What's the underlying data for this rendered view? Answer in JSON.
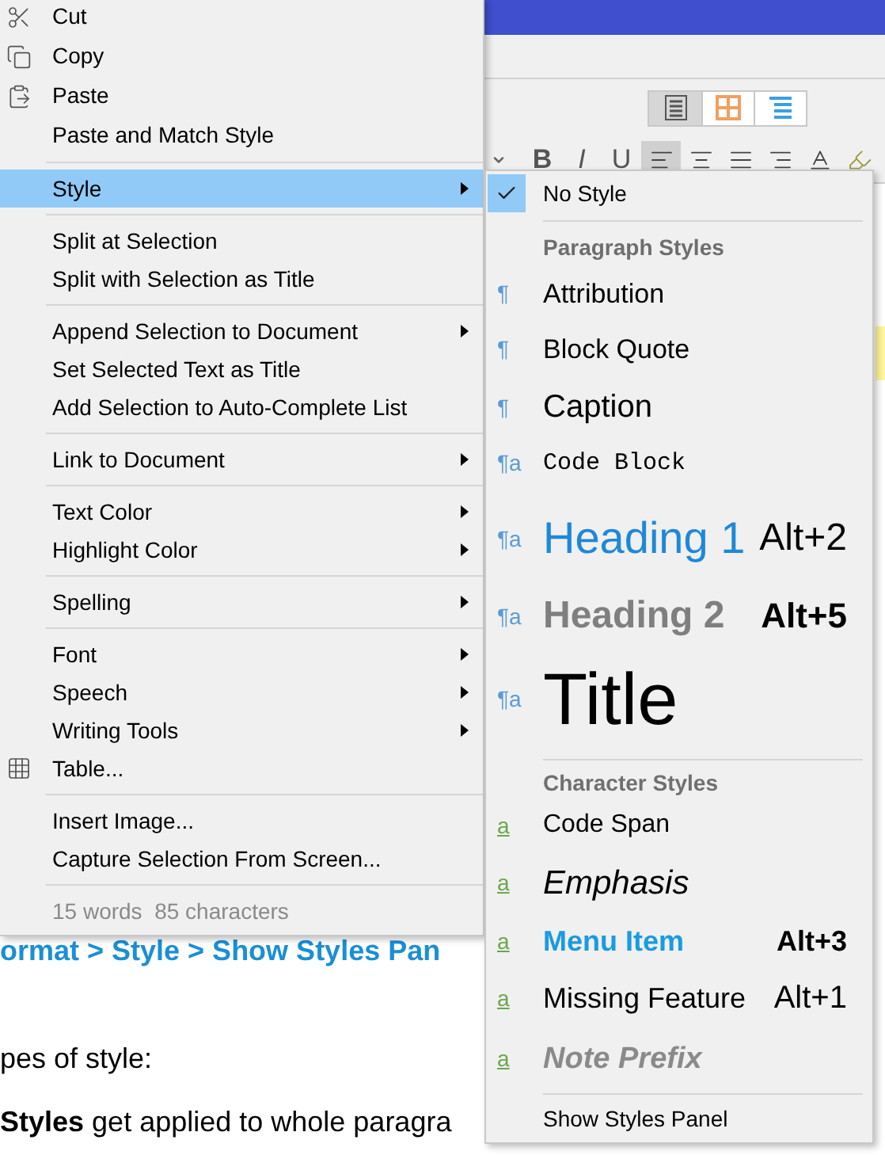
{
  "view_switcher": [
    {
      "kind": "list",
      "selected": true
    },
    {
      "kind": "grid",
      "selected": false
    },
    {
      "kind": "outline",
      "selected": false
    }
  ],
  "format_toolbar": [
    {
      "kind": "bold",
      "label": "B",
      "selected": false
    },
    {
      "kind": "italic",
      "label": "I",
      "selected": false
    },
    {
      "kind": "underline",
      "label": "U",
      "selected": false
    },
    {
      "kind": "align-left",
      "selected": true
    },
    {
      "kind": "align-center",
      "selected": false
    },
    {
      "kind": "align-justify",
      "selected": false
    },
    {
      "kind": "align-right",
      "selected": false
    },
    {
      "kind": "text-color",
      "selected": false
    },
    {
      "kind": "highlight",
      "selected": false
    }
  ],
  "document": {
    "lines": [
      {
        "kind": "link",
        "text": "ormat > Style > Show Styles Pan"
      },
      {
        "kind": "paragraph",
        "text": "pes of style:"
      },
      {
        "kind": "paragraph",
        "text": "**Styles** get applied to whole paragra"
      }
    ]
  },
  "context_menu": {
    "groups": [
      [
        {
          "label": "Cut",
          "kind": "cut",
          "has_submenu": false,
          "selected": false
        },
        {
          "label": "Copy",
          "kind": "copy",
          "has_submenu": false,
          "selected": false
        },
        {
          "label": "Paste",
          "kind": "paste",
          "has_submenu": false,
          "selected": false
        },
        {
          "label": "Paste and Match Style",
          "has_submenu": false,
          "selected": false
        }
      ],
      [
        {
          "label": "Style",
          "has_submenu": true,
          "selected": true
        }
      ],
      [
        {
          "label": "Split at Selection",
          "has_submenu": false,
          "selected": false
        },
        {
          "label": "Split with Selection as Title",
          "has_submenu": false,
          "selected": false
        }
      ],
      [
        {
          "label": "Append Selection to Document",
          "has_submenu": true,
          "selected": false
        },
        {
          "label": "Set Selected Text as Title",
          "has_submenu": false,
          "selected": false
        },
        {
          "label": "Add Selection to Auto-Complete List",
          "has_submenu": false,
          "selected": false
        }
      ],
      [
        {
          "label": "Link to Document",
          "has_submenu": true,
          "selected": false
        }
      ],
      [
        {
          "label": "Text Color",
          "has_submenu": true,
          "selected": false
        },
        {
          "label": "Highlight Color",
          "has_submenu": true,
          "selected": false
        }
      ],
      [
        {
          "label": "Spelling",
          "has_submenu": true,
          "selected": false
        }
      ],
      [
        {
          "label": "Font",
          "has_submenu": true,
          "selected": false
        },
        {
          "label": "Speech",
          "has_submenu": true,
          "selected": false
        },
        {
          "label": "Writing Tools",
          "has_submenu": true,
          "selected": false
        },
        {
          "label": "Table...",
          "kind": "table",
          "has_submenu": false,
          "selected": false
        }
      ],
      [
        {
          "label": "Insert Image...",
          "has_submenu": false,
          "selected": false
        },
        {
          "label": "Capture Selection From Screen...",
          "has_submenu": false,
          "selected": false
        }
      ]
    ],
    "status": "15 words  85 characters"
  },
  "style_submenu": {
    "no_style": {
      "label": "No Style",
      "checked": true
    },
    "sections": [
      {
        "kind": "paragraph",
        "header": "Paragraph Styles",
        "items": [
          {
            "label": "Attribution",
            "kind": "attribution",
            "icon": "¶"
          },
          {
            "label": "Block Quote",
            "kind": "block-quote",
            "icon": "¶"
          },
          {
            "label": "Caption",
            "kind": "caption",
            "icon": "¶"
          },
          {
            "label": "Code Block",
            "kind": "code-block",
            "icon": "¶a"
          },
          {
            "label": "Heading 1",
            "kind": "heading-1",
            "icon": "¶a",
            "shortcut": "Alt+2"
          },
          {
            "label": "Heading 2",
            "kind": "heading-2",
            "icon": "¶a",
            "shortcut": "Alt+5"
          },
          {
            "label": "Title",
            "kind": "title",
            "icon": "¶a"
          }
        ]
      },
      {
        "kind": "character",
        "header": "Character Styles",
        "items": [
          {
            "label": "Code Span",
            "kind": "code-span",
            "icon": "a"
          },
          {
            "label": "Emphasis",
            "kind": "emphasis",
            "icon": "a"
          },
          {
            "label": "Menu Item",
            "kind": "menu-item",
            "icon": "a",
            "shortcut": "Alt+3"
          },
          {
            "label": "Missing Feature",
            "kind": "missing-feature",
            "icon": "a",
            "shortcut": "Alt+1"
          },
          {
            "label": "Note Prefix",
            "kind": "note-prefix",
            "icon": "a"
          }
        ]
      }
    ],
    "footer": "Show Styles Panel"
  }
}
